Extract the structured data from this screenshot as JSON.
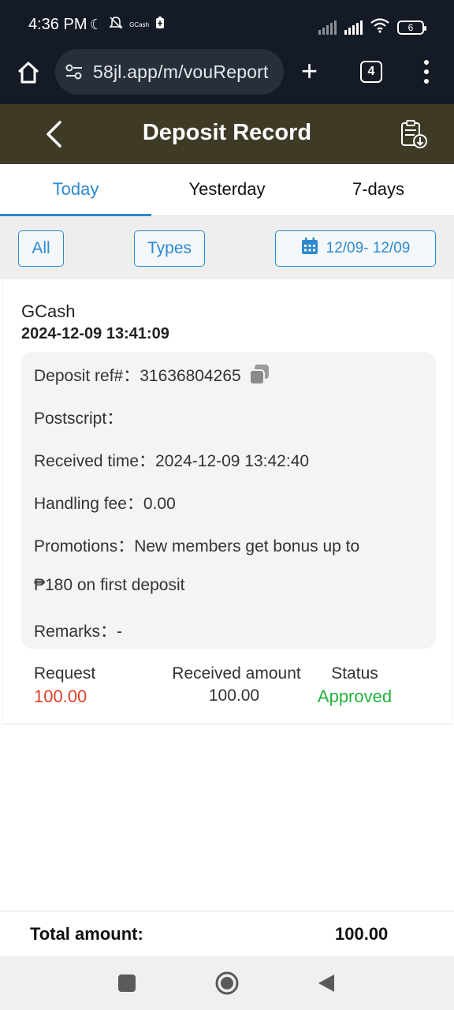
{
  "status_bar": {
    "time": "4:36 PM",
    "gcash_label": "GCash",
    "battery": "6"
  },
  "browser": {
    "url": "58jl.app/m/vouReport",
    "tab_count": "4"
  },
  "header": {
    "title": "Deposit Record"
  },
  "tabs": [
    {
      "label": "Today",
      "active": true
    },
    {
      "label": "Yesterday",
      "active": false
    },
    {
      "label": "7-days",
      "active": false
    }
  ],
  "filters": {
    "all_label": "All",
    "types_label": "Types",
    "date_range": "12/09- 12/09"
  },
  "record": {
    "method": "GCash",
    "datetime": "2024-12-09 13:41:09",
    "details": {
      "deposit_ref": "Deposit ref#：31636804265",
      "postscript": "Postscript：",
      "received_time": "Received time：2024-12-09 13:42:40",
      "handling_fee": "Handling fee：0.00",
      "promotions_line1": "Promotions：New members get bonus up to",
      "promotions_line2": "₱180 on first deposit",
      "remarks": "Remarks：-"
    },
    "summary": {
      "request_label": "Request",
      "request_value": "100.00",
      "received_label": "Received amount",
      "received_value": "100.00",
      "status_label": "Status",
      "status_value": "Approved"
    }
  },
  "footer": {
    "total_label": "Total amount:",
    "total_value": "100.00"
  },
  "colors": {
    "accent": "#2d8ad0",
    "header_bg": "#3f3a26",
    "request": "#e0402a",
    "approved": "#22b33a"
  },
  "icons": [
    "home-icon",
    "site-settings-icon",
    "plus-icon",
    "menu-icon",
    "back-icon",
    "report-download-icon",
    "calendar-icon",
    "copy-icon",
    "recents-icon",
    "home-circle-icon",
    "nav-back-icon"
  ]
}
